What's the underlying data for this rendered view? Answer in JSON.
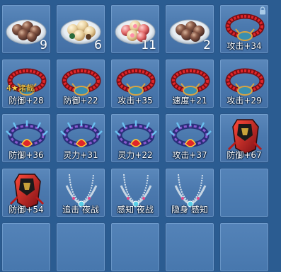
{
  "inventory": {
    "row1": [
      {
        "kind": "dumpling",
        "icon": "dumpling-plate-icon",
        "count": "9"
      },
      {
        "kind": "tangyuan",
        "icon": "tangyuan-plate-icon",
        "count": "6"
      },
      {
        "kind": "flowercake",
        "icon": "flower-cake-plate-icon",
        "count": "11"
      },
      {
        "kind": "dumpling",
        "icon": "dumpling-plate-icon",
        "count": "2"
      },
      {
        "kind": "red-bracelet",
        "icon": "red-bracelet-icon",
        "stat": "攻击+34",
        "locked": true
      }
    ],
    "row2": [
      {
        "icon": "red-bracelet-icon",
        "stat": "防御+28",
        "refine": "4★堵截"
      },
      {
        "icon": "red-bracelet-icon",
        "stat": "防御+22"
      },
      {
        "icon": "red-bracelet-icon",
        "stat": "攻击+35"
      },
      {
        "icon": "red-bracelet-icon",
        "stat": "速度+21"
      },
      {
        "icon": "red-bracelet-icon",
        "stat": "攻击+29"
      }
    ],
    "row3": [
      {
        "icon": "spiked-bracelet-icon",
        "stat": "防御+36"
      },
      {
        "icon": "spiked-bracelet-icon",
        "stat": "灵力+31"
      },
      {
        "icon": "spiked-bracelet-icon",
        "stat": "灵力+22"
      },
      {
        "icon": "spiked-bracelet-icon",
        "stat": "攻击+37"
      },
      {
        "icon": "dragon-armor-icon",
        "stat": "防御+67"
      }
    ],
    "row4": [
      {
        "icon": "dragon-armor-icon",
        "stat": "防御+54"
      },
      {
        "icon": "silver-necklace-icon",
        "stat": "追击 夜战"
      },
      {
        "icon": "silver-necklace-icon",
        "stat": "感知 夜战"
      },
      {
        "icon": "silver-necklace-icon",
        "stat": "隐身 感知"
      },
      {
        "icon": "empty-slot"
      }
    ]
  },
  "colors": {
    "background": "#2b5c91",
    "slot": "#4b79ae",
    "stat_text": "#ffffff",
    "refine_text": "#ffd34d"
  }
}
